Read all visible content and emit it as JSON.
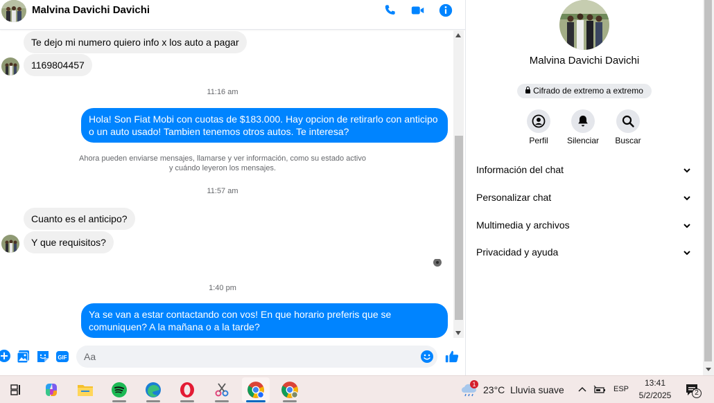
{
  "chat": {
    "contact_name": "Malvina Davichi Davichi",
    "messages": {
      "m1": "Te dejo mi numero quiero info x los auto a pagar",
      "m2": "1169804457",
      "t1": "11:16 am",
      "m3": "Hola! Son Fiat Mobi con cuotas de $183.000. Hay opcion de retirarlo con anticipo o un auto usado! Tambien tenemos otros autos. Te interesa?",
      "notice_line1": "Ahora pueden enviarse mensajes, llamarse y ver información, como su estado activo",
      "notice_line2": "y cuándo leyeron los mensajes.",
      "t2": "11:57 am",
      "m4": "Cuanto es el anticipo?",
      "m5": "Y que requisitos?",
      "t3": "1:40 pm",
      "m6": "Ya se van a estar contactando con vos! En que horario preferis que se comuniquen? A la mañana o a la tarde?"
    },
    "composer": {
      "placeholder": "Aa",
      "icons": [
        "plus-icon",
        "photo-icon",
        "sticker-icon",
        "gif-icon",
        "emoji-icon",
        "like-icon"
      ],
      "gif_label": "GIF"
    },
    "header_icons": [
      "phone-icon",
      "video-icon",
      "info-icon"
    ]
  },
  "info_panel": {
    "name": "Malvina Davichi Davichi",
    "e2ee_label": "Cifrado de extremo a extremo",
    "actions": [
      {
        "label": "Perfil",
        "icon": "profile-icon"
      },
      {
        "label": "Silenciar",
        "icon": "bell-icon"
      },
      {
        "label": "Buscar",
        "icon": "search-icon"
      }
    ],
    "sections": [
      {
        "label": "Información del chat"
      },
      {
        "label": "Personalizar chat"
      },
      {
        "label": "Multimedia y archivos"
      },
      {
        "label": "Privacidad y ayuda"
      }
    ]
  },
  "taskbar": {
    "apps": [
      "task-view-icon",
      "copilot-icon",
      "file-explorer-icon",
      "spotify-icon",
      "edge-icon",
      "opera-icon",
      "snipping-tool-icon",
      "chrome-icon",
      "chrome-profile-icon"
    ],
    "weather": {
      "temp": "23°C",
      "desc": "Lluvia suave",
      "badge": "1"
    },
    "lang": "ESP",
    "time": "13:41",
    "date": "5/2/2025",
    "notif_count": "2"
  },
  "colors": {
    "accent": "#0084ff",
    "incoming_bubble": "#f0f0f0",
    "muted_text": "#65676b",
    "taskbar": "#f3e9e8"
  }
}
